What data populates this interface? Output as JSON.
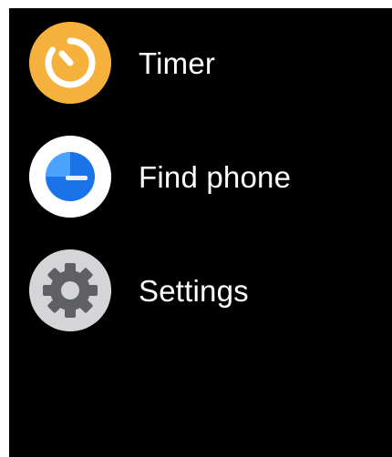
{
  "apps": [
    {
      "label": "Timer",
      "icon": "timer-icon",
      "icon_background": "#f6b13c",
      "icon_foreground": "#ffffff"
    },
    {
      "label": "Find phone",
      "icon": "find-phone-icon",
      "icon_background": "#ffffff",
      "icon_foreground": "#1a73e8"
    },
    {
      "label": "Settings",
      "icon": "gear-icon",
      "icon_background": "#d5d5d8",
      "icon_foreground": "#5f6064"
    }
  ],
  "colors": {
    "screen_background": "#000000",
    "label_text": "#ffffff"
  }
}
